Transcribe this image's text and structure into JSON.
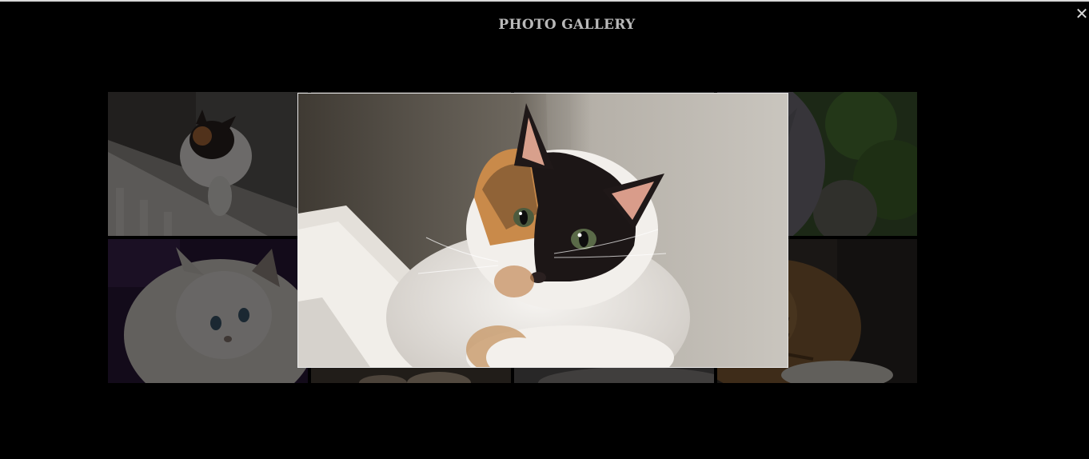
{
  "gallery": {
    "title": "PHOTO GALLERY",
    "close_symbol": "✕"
  },
  "thumbnails": [
    {
      "name": "calico-cat-on-railing"
    },
    {
      "name": "calico-cat-closeup"
    },
    {
      "name": "grey-cat"
    },
    {
      "name": "grey-cat-green-background"
    },
    {
      "name": "fluffy-white-cat"
    },
    {
      "name": "cat-paws"
    },
    {
      "name": "grey-fur-cat"
    },
    {
      "name": "tabby-cat"
    }
  ],
  "viewer": {
    "active_image": "calico-cat-closeup"
  }
}
